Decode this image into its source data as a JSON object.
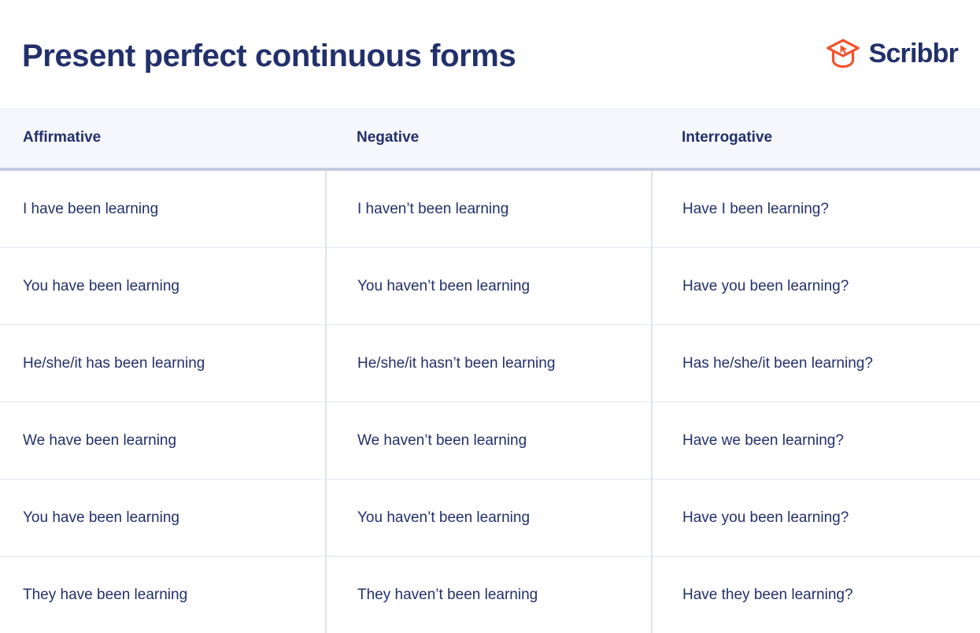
{
  "page": {
    "title": "Present perfect continuous forms"
  },
  "brand": {
    "name": "Scribbr",
    "logo_icon": "graduation-cap-icon",
    "accent_color": "#f4522c",
    "text_color": "#22306b"
  },
  "colors": {
    "navy": "#22306b",
    "orange": "#f4522c",
    "header_background": "#f5f7fc",
    "header_rule": "#c5cce0",
    "row_rule": "#e3e7f2",
    "column_rule": "#dde2ee",
    "page_background": "#ffffff"
  },
  "table": {
    "columns": [
      "Affirmative",
      "Negative",
      "Interrogative"
    ],
    "rows": [
      {
        "affirmative": "I have been learning",
        "negative": "I haven’t been learning",
        "interrogative": "Have I been learning?"
      },
      {
        "affirmative": "You have been learning",
        "negative": "You haven’t been learning",
        "interrogative": "Have you been learning?"
      },
      {
        "affirmative": "He/she/it has been learning",
        "negative": "He/she/it hasn’t been learning",
        "interrogative": "Has he/she/it been learning?"
      },
      {
        "affirmative": "We have been learning",
        "negative": "We haven’t been learning",
        "interrogative": "Have we been learning?"
      },
      {
        "affirmative": "You have been learning",
        "negative": "You haven’t been learning",
        "interrogative": "Have you been learning?"
      },
      {
        "affirmative": "They have been learning",
        "negative": "They haven’t been learning",
        "interrogative": "Have they been learning?"
      }
    ]
  }
}
